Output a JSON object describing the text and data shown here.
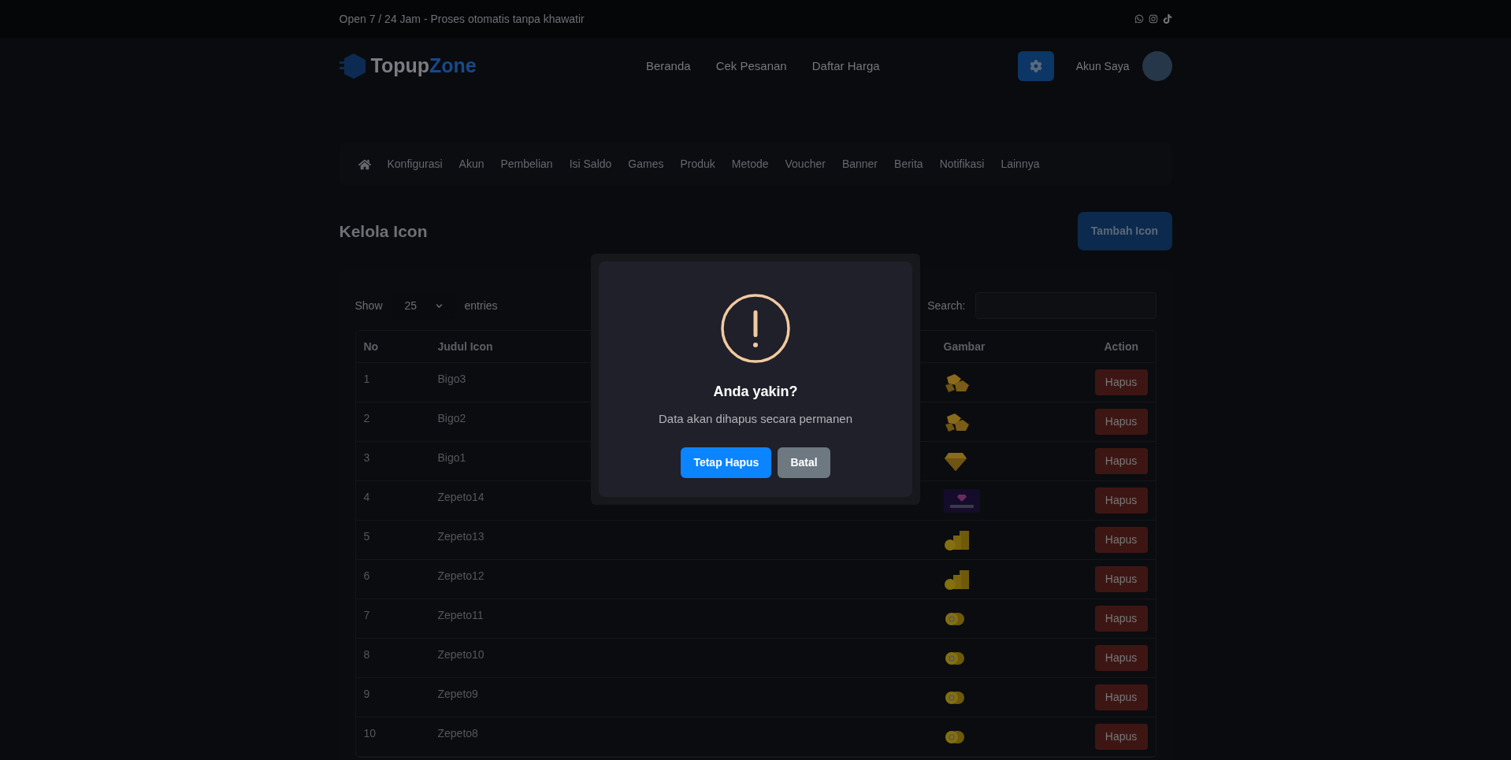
{
  "topbar": {
    "text": "Open 7 / 24 Jam - Proses otomatis tanpa khawatir"
  },
  "header": {
    "logo": {
      "part_1": "Topup",
      "part_2": "Zone"
    },
    "nav": [
      {
        "label": "Beranda"
      },
      {
        "label": "Cek Pesanan"
      },
      {
        "label": "Daftar Harga"
      }
    ],
    "account": "Akun Saya"
  },
  "admin_menu": [
    {
      "label": "Konfigurasi"
    },
    {
      "label": "Akun"
    },
    {
      "label": "Pembelian"
    },
    {
      "label": "Isi Saldo"
    },
    {
      "label": "Games"
    },
    {
      "label": "Produk"
    },
    {
      "label": "Metode"
    },
    {
      "label": "Voucher"
    },
    {
      "label": "Banner"
    },
    {
      "label": "Berita"
    },
    {
      "label": "Notifikasi"
    },
    {
      "label": "Lainnya"
    }
  ],
  "page_title": "Kelola Icon",
  "add_button": "Tambah Icon",
  "table_controls": {
    "show_label": "Show",
    "page_size": "25",
    "entries_label": "entries",
    "search_label": "Search:"
  },
  "table": {
    "columns": [
      "No",
      "Judul Icon",
      "Gambar",
      "Action"
    ],
    "rows": [
      {
        "no": "1",
        "title": "Bigo3",
        "kind": "nuggets",
        "action": "Hapus"
      },
      {
        "no": "2",
        "title": "Bigo2",
        "kind": "nuggets",
        "action": "Hapus"
      },
      {
        "no": "3",
        "title": "Bigo1",
        "kind": "diamond",
        "action": "Hapus"
      },
      {
        "no": "4",
        "title": "Zepeto14",
        "kind": "banner",
        "action": "Hapus"
      },
      {
        "no": "5",
        "title": "Zepeto13",
        "kind": "coinstack",
        "action": "Hapus"
      },
      {
        "no": "6",
        "title": "Zepeto12",
        "kind": "coinstack",
        "action": "Hapus"
      },
      {
        "no": "7",
        "title": "Zepeto11",
        "kind": "coin",
        "action": "Hapus"
      },
      {
        "no": "8",
        "title": "Zepeto10",
        "kind": "coin",
        "action": "Hapus"
      },
      {
        "no": "9",
        "title": "Zepeto9",
        "kind": "coin",
        "action": "Hapus"
      },
      {
        "no": "10",
        "title": "Zepeto8",
        "kind": "coin",
        "action": "Hapus"
      }
    ]
  },
  "dialog": {
    "title": "Anda yakin?",
    "message": "Data akan dihapus secara permanen",
    "confirm": "Tetap Hapus",
    "cancel": "Batal"
  }
}
